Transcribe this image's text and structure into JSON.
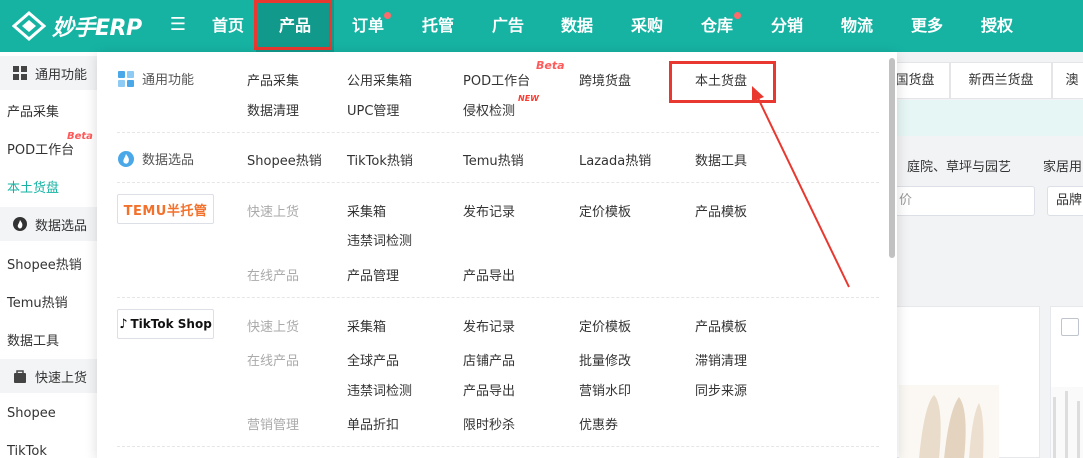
{
  "header": {
    "logo_text": "妙手ERP",
    "nav": [
      {
        "label": "首页"
      },
      {
        "label": "产品"
      },
      {
        "label": "订单"
      },
      {
        "label": "托管"
      },
      {
        "label": "广告"
      },
      {
        "label": "数据"
      },
      {
        "label": "采购"
      },
      {
        "label": "仓库"
      },
      {
        "label": "分销"
      },
      {
        "label": "物流"
      },
      {
        "label": "更多"
      },
      {
        "label": "授权"
      }
    ]
  },
  "sidebar": {
    "group_common": "通用功能",
    "item_collect": "产品采集",
    "item_pod": "POD工作台",
    "item_pod_badge": "Beta",
    "item_local": "本土货盘",
    "group_data": "数据选品",
    "item_shopee": "Shopee热销",
    "item_temu": "Temu热销",
    "item_tools": "数据工具",
    "group_quick": "快速上货",
    "item_shopee2": "Shopee",
    "item_tiktok": "TikTok"
  },
  "background": {
    "tab1": "国货盘",
    "tab2": "新西兰货盘",
    "tab3": "澳",
    "cat1": "庭院、草坪与园艺",
    "cat2": "家居用",
    "input_price": "价",
    "input_brand": "品牌"
  },
  "dropdown": {
    "common": {
      "title": "通用功能",
      "links": {
        "product_collect": "产品采集",
        "public_box": "公用采集箱",
        "pod": "POD工作台",
        "pod_badge": "Beta",
        "cross_border": "跨境货盘",
        "local_supply": "本土货盘",
        "data_clean": "数据清理",
        "upc": "UPC管理",
        "infringement": "侵权检测",
        "infringement_badge": "NEW"
      }
    },
    "data": {
      "title": "数据选品",
      "links": {
        "shopee": "Shopee热销",
        "tiktok": "TikTok热销",
        "temu": "Temu热销",
        "lazada": "Lazada热销",
        "tools": "数据工具"
      }
    },
    "temu": {
      "brand": "TEMU半托管",
      "quick_label": "快速上货",
      "online_label": "在线产品",
      "links": {
        "collect_box": "采集箱",
        "publish_log": "发布记录",
        "price_template": "定价模板",
        "product_template": "产品模板",
        "banned_words": "违禁词检测",
        "product_manage": "产品管理",
        "product_export": "产品导出"
      }
    },
    "tiktok": {
      "brand": "TikTok Shop",
      "quick_label": "快速上货",
      "online_label": "在线产品",
      "marketing_label": "营销管理",
      "links": {
        "collect_box": "采集箱",
        "publish_log": "发布记录",
        "price_template": "定价模板",
        "product_template": "产品模板",
        "global_products": "全球产品",
        "store_products": "店铺产品",
        "batch_edit": "批量修改",
        "slow_clear": "滞销清理",
        "banned_words": "违禁词检测",
        "product_export": "产品导出",
        "watermark": "营销水印",
        "sync_source": "同步来源",
        "single_discount": "单品折扣",
        "flash_sale": "限时秒杀",
        "coupon": "优惠券"
      }
    }
  },
  "colors": {
    "brand": "#16b3a3",
    "highlight": "#e8382f",
    "beta": "#ff5a5a"
  }
}
